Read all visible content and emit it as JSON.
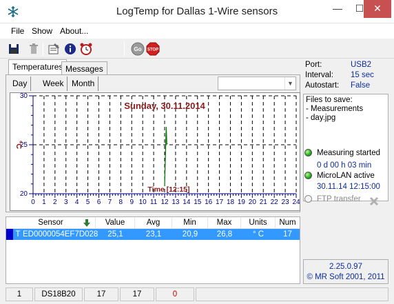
{
  "window": {
    "title": "LogTemp for Dallas 1-Wire sensors",
    "min_glyph": "—",
    "max_glyph": "☐",
    "close_glyph": "✕"
  },
  "menu": [
    "File",
    "Show",
    "About..."
  ],
  "toolbar_icons": [
    "save-icon",
    "delete-icon",
    "properties-icon",
    "info-icon",
    "alarm-icon",
    "go-icon",
    "stop-icon"
  ],
  "toolbar_text": {
    "go": "Go",
    "stop": "STOP"
  },
  "tabs": {
    "temperatures": "Temperatures",
    "messages": "Messages"
  },
  "subtabs": {
    "day": "Day",
    "week": "Week",
    "month": "Month"
  },
  "combo": {
    "value": "",
    "arrow": "▼"
  },
  "chart_data": {
    "type": "line",
    "title": "Sunday, 30.11.2014",
    "ylabel": "°C",
    "ylim": [
      20,
      30
    ],
    "y_ticks": [
      "30",
      "25",
      "20"
    ],
    "xlim": [
      0,
      24
    ],
    "x_ticks": [
      "0",
      "1",
      "2",
      "3",
      "4",
      "5",
      "6",
      "7",
      "8",
      "9",
      "10",
      "11",
      "12",
      "13",
      "14",
      "15",
      "16",
      "17",
      "18",
      "19",
      "20",
      "21",
      "22",
      "23",
      "24"
    ],
    "cursor_label": "Time [12:15]",
    "series": [
      {
        "x": [
          12.0,
          12.05,
          12.1,
          12.15,
          12.2,
          12.25
        ],
        "y": [
          20.8,
          23.0,
          25.1,
          26.8,
          25.1,
          25.1
        ],
        "color": "#0a7a0a"
      }
    ],
    "colors": {
      "title": "#8b1a1a",
      "cursor_label": "#8b1a1a",
      "axis": "#000080",
      "grid": "#000000"
    }
  },
  "info": {
    "port_label": "Port:",
    "port_value": "USB2",
    "interval_label": "Interval:",
    "interval_value": "15 sec",
    "autostart_label": "Autostart:",
    "autostart_value": "False"
  },
  "files": {
    "heading": "Files to save:",
    "items": [
      "- Measurements",
      "- day.jpg"
    ]
  },
  "status": {
    "measuring": "Measuring started",
    "duration": "0 d 00 h 03 min",
    "microlan": "MicroLAN active",
    "datetime": "30.11.14 12:15:00",
    "ftp": "FTP transfer"
  },
  "version": {
    "number": "2.25.0.97",
    "copyright": "© MR Soft 2001, 2011"
  },
  "table": {
    "headers": [
      "Sensor",
      "Value",
      "Avg",
      "Min",
      "Max",
      "Units",
      "Num"
    ],
    "rows": [
      {
        "flag": "T",
        "sensor": "ED0000054EF7D028",
        "value": "25,1",
        "avg": "23,1",
        "min": "20,9",
        "max": "26,8",
        "units": "° C",
        "num": "17"
      }
    ]
  },
  "statusbar": [
    "1",
    "DS18B20",
    "17",
    "17",
    "0"
  ],
  "colors": {
    "selection": "#3399ff",
    "value_text": "#0b2c9e",
    "close_button": "#c75050",
    "statusbar_red": "#cc0000"
  }
}
